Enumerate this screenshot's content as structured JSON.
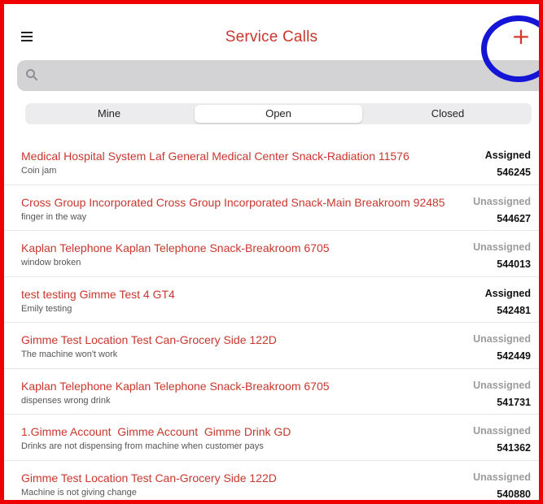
{
  "header": {
    "title": "Service Calls",
    "menu_icon": "hamburger-menu-icon",
    "add_label": "+",
    "title_color": "#c8372d"
  },
  "search": {
    "placeholder": "",
    "icon": "search-icon"
  },
  "segments": [
    {
      "label": "Mine",
      "active": false
    },
    {
      "label": "Open",
      "active": true
    },
    {
      "label": "Closed",
      "active": false
    }
  ],
  "calls": [
    {
      "title": "Medical Hospital System Laf General Medical Center Snack-Radiation 11576",
      "subtitle": "Coin jam",
      "status": "Assigned",
      "id": "546245"
    },
    {
      "title": "Cross Group Incorporated Cross Group Incorporated Snack-Main Breakroom 92485",
      "subtitle": "finger in the way",
      "status": "Unassigned",
      "id": "544627"
    },
    {
      "title": "Kaplan Telephone Kaplan Telephone Snack-Breakroom 6705",
      "subtitle": "window broken",
      "status": "Unassigned",
      "id": "544013"
    },
    {
      "title": "test testing Gimme Test 4 GT4",
      "subtitle": "Emily testing",
      "status": "Assigned",
      "id": "542481"
    },
    {
      "title": "Gimme Test Location Test Can-Grocery Side 122D",
      "subtitle": "The machine won't work",
      "status": "Unassigned",
      "id": "542449"
    },
    {
      "title": "Kaplan Telephone Kaplan Telephone Snack-Breakroom 6705",
      "subtitle": "dispenses wrong drink",
      "status": "Unassigned",
      "id": "541731"
    },
    {
      "title": "1.Gimme Account  Gimme Account  Gimme Drink GD",
      "subtitle": "Drinks are not dispensing from machine when customer pays",
      "status": "Unassigned",
      "id": "541362"
    },
    {
      "title": "Gimme Test Location Test Can-Grocery Side 122D",
      "subtitle": "Machine is not giving change",
      "status": "Unassigned",
      "id": "540880"
    }
  ],
  "colors": {
    "frame_border": "#ee0000",
    "highlight_circle": "#1515d8",
    "accent": "#c8372d"
  }
}
